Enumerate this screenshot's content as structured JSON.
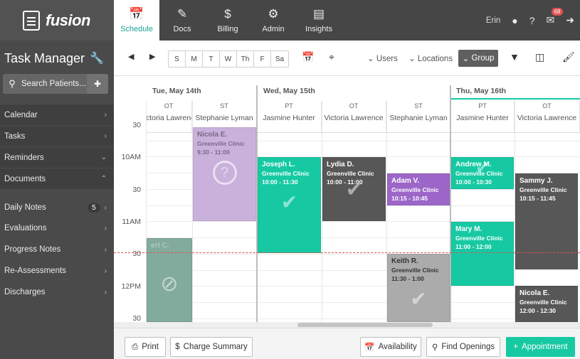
{
  "sidebar": {
    "logo_text": "fusion",
    "app_title": "Task Manager",
    "search_placeholder": "Search Patients...",
    "items": [
      {
        "label": "Calendar",
        "chevron": "›"
      },
      {
        "label": "Tasks",
        "chevron": "›"
      },
      {
        "label": "Reminders",
        "chevron": "⌄"
      },
      {
        "label": "Documents",
        "chevron": "⌃"
      }
    ],
    "sub_items": [
      {
        "label": "Daily Notes",
        "badge": "5"
      },
      {
        "label": "Evaluations"
      },
      {
        "label": "Progress Notes"
      },
      {
        "label": "Re-Assessments"
      },
      {
        "label": "Discharges"
      }
    ]
  },
  "tabs": [
    {
      "label": "Schedule",
      "icon": "calendar-icon",
      "active": true
    },
    {
      "label": "Docs",
      "icon": "pencil-icon"
    },
    {
      "label": "Billing",
      "icon": "dollar-icon"
    },
    {
      "label": "Admin",
      "icon": "gears-icon"
    },
    {
      "label": "Insights",
      "icon": "bar-chart-icon"
    }
  ],
  "user": {
    "name": "Erin",
    "mail_count": "68"
  },
  "toolbar": {
    "days": [
      "S",
      "M",
      "T",
      "W",
      "Th",
      "F",
      "Sa"
    ],
    "users_label": "Users",
    "locations_label": "Locations",
    "group_label": "Group"
  },
  "calendar": {
    "dates": [
      "Tue, May 14th",
      "Wed, May 15th",
      "Thu, May 16th"
    ],
    "columns": [
      {
        "disc": "OT",
        "provider": "ctoria Lawrence"
      },
      {
        "disc": "ST",
        "provider": "Stephanie Lyman"
      },
      {
        "disc": "PT",
        "provider": "Jasmine Hunter"
      },
      {
        "disc": "OT",
        "provider": "Victoria Lawrence"
      },
      {
        "disc": "ST",
        "provider": "Stephanie Lyman"
      },
      {
        "disc": "PT",
        "provider": "Jasmine Hunter"
      },
      {
        "disc": "OT",
        "provider": "Victoria Lawrence"
      }
    ],
    "times": [
      "30",
      "10AM",
      "30",
      "11AM",
      "30",
      "12PM",
      "30"
    ],
    "appointments": [
      {
        "name": "Nicola E.",
        "clinic": "Greenville Clinic",
        "time": "9:30 - 11:00",
        "status": "?"
      },
      {
        "name": "Joseph L.",
        "clinic": "Greenville Clinic",
        "time": "10:00 - 11:30",
        "status": "✔"
      },
      {
        "name": "Lydia D.",
        "clinic": "Greenville Clinic",
        "time": "10:00 - 11:00",
        "status": "✔"
      },
      {
        "name": "Adam V.",
        "clinic": "Greenville Clinic",
        "time": "10:15 - 10:45",
        "status": ""
      },
      {
        "name": "Andrew M.",
        "clinic": "Greenville Clinic",
        "time": "10:00 - 10:30",
        "status": "✔"
      },
      {
        "name": "Sammy J.",
        "clinic": "Greenville Clinic",
        "time": "10:15 - 11:45",
        "status": ""
      },
      {
        "name": "Mary M.",
        "clinic": "Greenville Clinic",
        "time": "11:00 - 12:00",
        "status": ""
      },
      {
        "name": "Keith R.",
        "clinic": "Greenville Clinic",
        "time": "11:30 - 1:00",
        "status": "✔"
      },
      {
        "name": "Nicola E.",
        "clinic": "Greenville Clinic",
        "time": "12:00 - 12:30",
        "status": ""
      },
      {
        "name": "ert C.",
        "clinic": "",
        "time": "",
        "status": "⊘"
      }
    ]
  },
  "bottom": {
    "print": "Print",
    "charge_summary": "Charge Summary",
    "availability": "Availability",
    "find_openings": "Find Openings",
    "appointment": "Appointment"
  },
  "colors": {
    "accent": "#16c9a3",
    "sidebar_bg": "#4a4a4a",
    "topbar_bg": "#464646",
    "appt_dark": "#575757",
    "appt_purple": "#9b66c8",
    "appt_lilac": "#c9b1dc",
    "appt_grey": "#ababab",
    "appt_sage": "#83ab9d"
  }
}
